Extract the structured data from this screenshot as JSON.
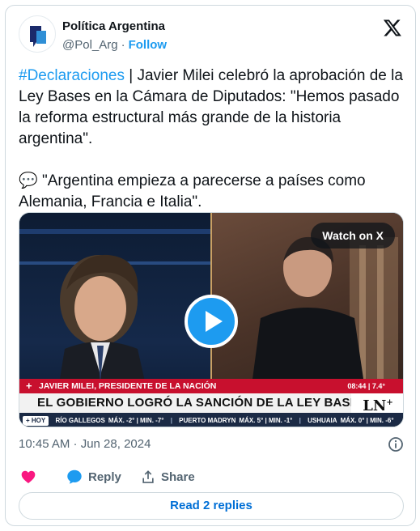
{
  "account": {
    "name": "Política Argentina",
    "handle": "@Pol_Arg",
    "separator": "·",
    "follow_label": "Follow"
  },
  "tweet": {
    "hashtag": "#Declaraciones",
    "paragraph1_rest": " | Javier Milei celebró la aprobación de la Ley Bases en la Cámara de Diputados: \"Hemos pasado la reforma estructural más grande de la historia argentina\".",
    "paragraph2_emoji": "💬",
    "paragraph2_text": " \"Argentina empieza a parecerse a países como Alemania, Francia e Italia\"."
  },
  "video": {
    "watch_label": "Watch on X",
    "lower_third_name": "JAVIER MILEI, PRESIDENTE DE LA NACIÓN",
    "broadcast_time": "08:44 | 7.4°",
    "headline": "EL GOBIERNO LOGRÓ LA SANCIÓN DE LA LEY BASES",
    "channel_logo": "LN",
    "channel_logo_plus": "+",
    "ticker_tag": "+ HOY",
    "ticker": [
      {
        "city": "RÍO GALLEGOS",
        "temps": "MÁX. -2° | MIN. -7°"
      },
      {
        "city": "PUERTO MADRYN",
        "temps": "MÁX. 5° | MIN. -1°"
      },
      {
        "city": "USHUAIA",
        "temps": "MÁX. 0° | MIN. -6°"
      }
    ]
  },
  "meta": {
    "timestamp": "10:45 AM · Jun 28, 2024"
  },
  "actions": {
    "reply_label": "Reply",
    "share_label": "Share",
    "read_replies_label": "Read 2 replies"
  },
  "colors": {
    "accent": "#1d9bf0",
    "like": "#f91880",
    "lower_third_red": "#c8102e"
  },
  "icons": [
    "account-avatar",
    "x-logo-icon",
    "play-icon",
    "info-icon",
    "heart-icon",
    "reply-icon",
    "share-icon",
    "speech-balloon-emoji"
  ]
}
